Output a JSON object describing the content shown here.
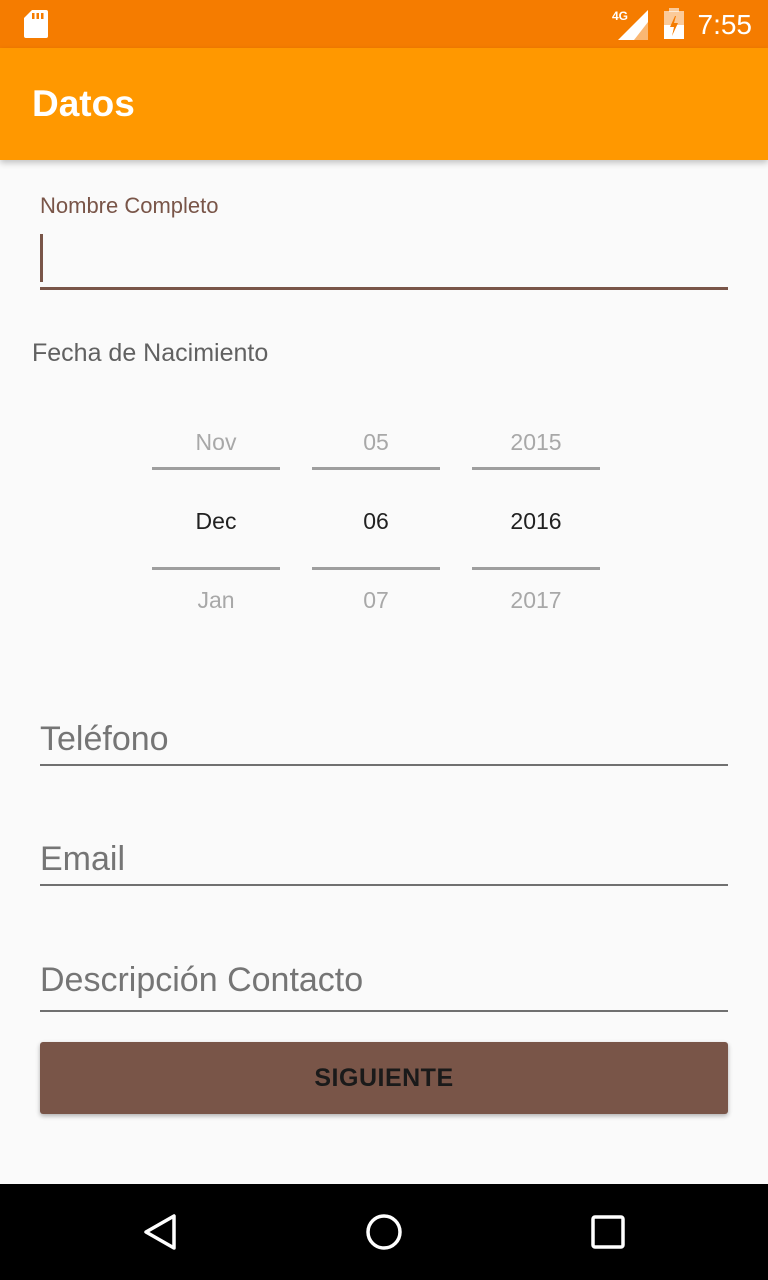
{
  "status_bar": {
    "time": "7:55",
    "network": "4G",
    "background_color": "#f57c00",
    "icons": [
      "sd-card-icon",
      "signal-icon",
      "battery-icon"
    ]
  },
  "app_bar": {
    "title": "Datos",
    "background_color": "#ff9800"
  },
  "form": {
    "name_label": "Nombre Completo",
    "name_value": "",
    "birthdate_label": "Fecha de Nacimiento",
    "date_picker": {
      "month": {
        "prev": "Nov",
        "current": "Dec",
        "next": "Jan"
      },
      "day": {
        "prev": "05",
        "current": "06",
        "next": "07"
      },
      "year": {
        "prev": "2015",
        "current": "2016",
        "next": "2017"
      }
    },
    "phone_placeholder": "Teléfono",
    "email_placeholder": "Email",
    "description_placeholder": "Descripción Contacto",
    "next_button": "SIGUIENTE",
    "accent_color": "#795548"
  },
  "nav_bar": {
    "icons": [
      "back-icon",
      "home-icon",
      "recents-icon"
    ]
  }
}
